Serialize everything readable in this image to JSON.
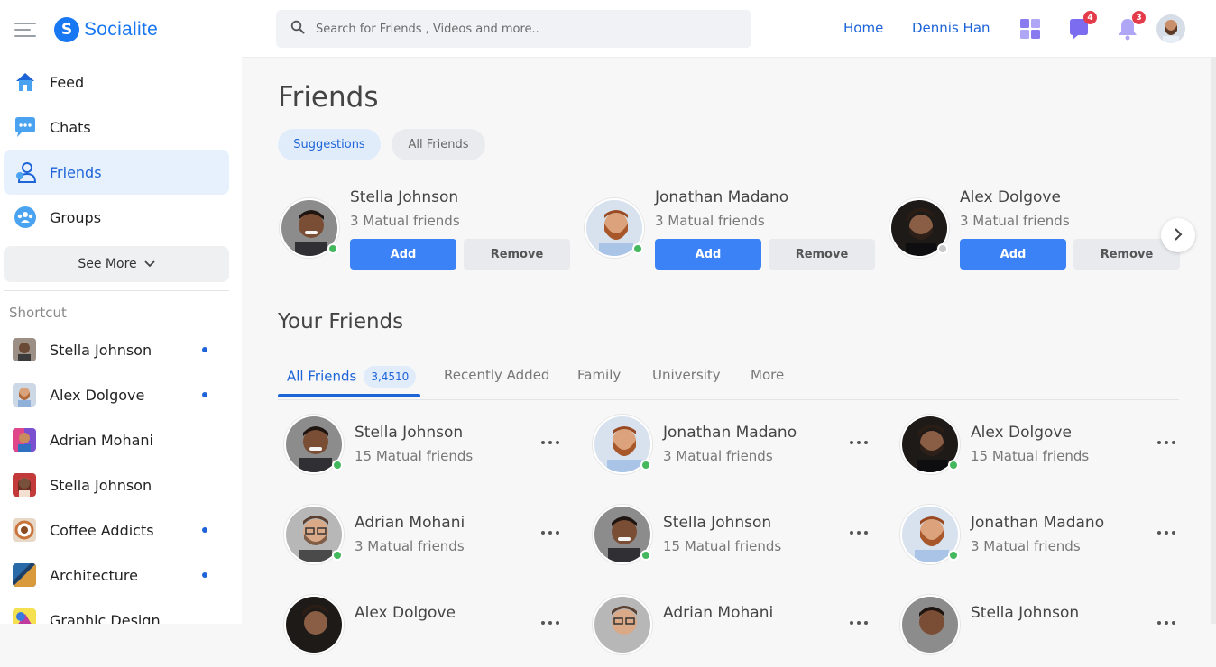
{
  "app": {
    "name": "Socialite",
    "logo_letter": "S"
  },
  "sidebar": {
    "items": [
      {
        "label": "Feed",
        "icon": "home-icon"
      },
      {
        "label": "Chats",
        "icon": "chat-icon"
      },
      {
        "label": "Friends",
        "icon": "friends-icon",
        "active": true
      },
      {
        "label": "Groups",
        "icon": "groups-icon"
      }
    ],
    "see_more": "See More",
    "shortcut_title": "Shortcut",
    "shortcuts": [
      {
        "label": "Stella Johnson",
        "dot": true
      },
      {
        "label": "Alex Dolgove",
        "dot": true
      },
      {
        "label": "Adrian Mohani",
        "dot": false
      },
      {
        "label": "Stella Johnson",
        "dot": false
      },
      {
        "label": "Coffee Addicts",
        "dot": true
      },
      {
        "label": "Architecture",
        "dot": true
      },
      {
        "label": "Graphic Design",
        "dot": false
      }
    ]
  },
  "header": {
    "search_placeholder": "Search for Friends , Videos and more..",
    "home": "Home",
    "user": "Dennis Han",
    "messages_badge": "4",
    "notifications_badge": "3"
  },
  "page": {
    "title": "Friends",
    "tabs": [
      "Suggestions",
      "All Friends"
    ],
    "add_label": "Add",
    "remove_label": "Remove",
    "suggestions": [
      {
        "name": "Stella Johnson",
        "sub": "3 Matual friends",
        "online": true
      },
      {
        "name": "Jonathan Madano",
        "sub": "3 Matual friends",
        "online": true
      },
      {
        "name": "Alex Dolgove",
        "sub": "3 Matual friends",
        "online": false
      }
    ],
    "your_friends_title": "Your Friends",
    "friend_tabs": [
      "All Friends",
      "Recently Added",
      "Family",
      "University",
      "More"
    ],
    "all_friends_count": "3,4510",
    "friends": [
      {
        "name": "Stella Johnson",
        "sub": "15 Matual friends"
      },
      {
        "name": "Jonathan Madano",
        "sub": "3 Matual friends"
      },
      {
        "name": "Alex Dolgove",
        "sub": "15 Matual friends"
      },
      {
        "name": "Adrian Mohani",
        "sub": "3 Matual friends"
      },
      {
        "name": "Stella Johnson",
        "sub": "15 Matual friends"
      },
      {
        "name": "Jonathan Madano",
        "sub": "3 Matual friends"
      },
      {
        "name": "Alex Dolgove",
        "sub": ""
      },
      {
        "name": "Adrian Mohani",
        "sub": ""
      },
      {
        "name": "Stella Johnson",
        "sub": ""
      }
    ]
  },
  "colors": {
    "accent": "#1d64d8",
    "button": "#3b82f6",
    "online": "#44b85c",
    "badge": "#e43b4b"
  }
}
